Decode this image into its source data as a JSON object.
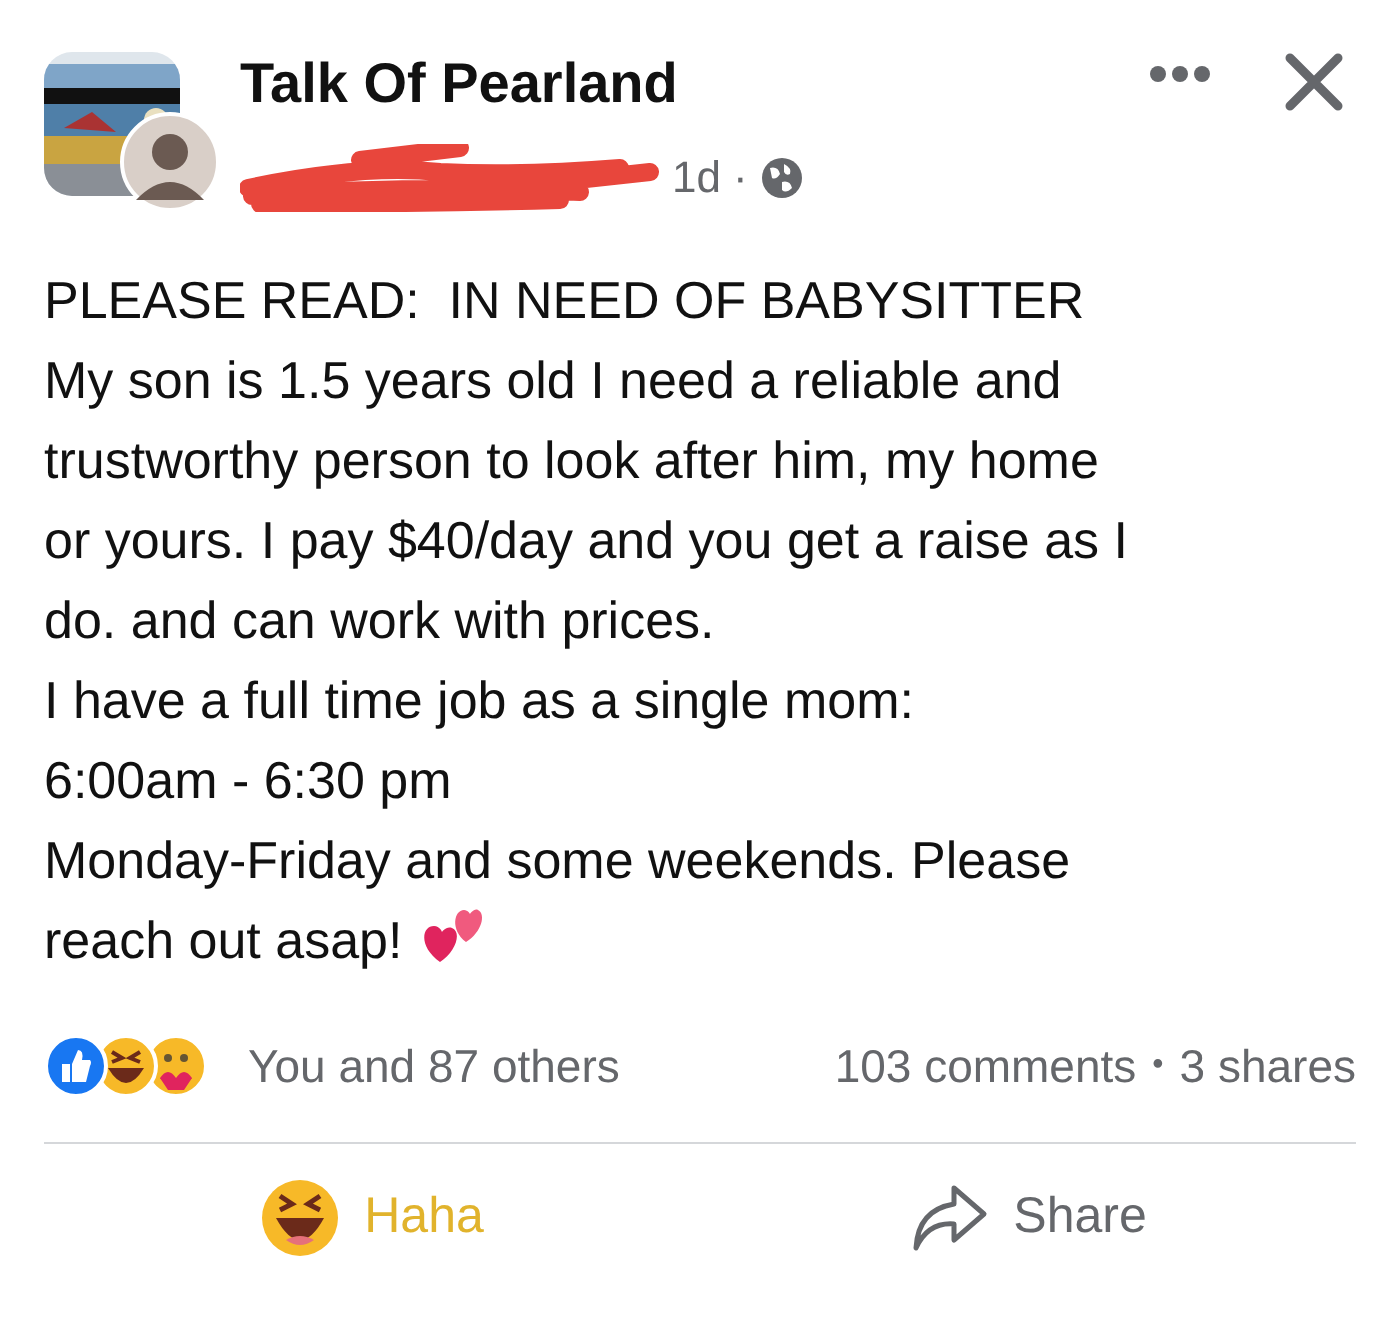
{
  "post": {
    "author": "Talk Of Pearland",
    "time": "1d",
    "separator": "·",
    "paragraphs": [
      "PLEASE READ:  IN NEED OF BABYSITTER",
      "My son is 1.5 years old I need a reliable and",
      "trustworthy person to look after him, my home",
      "or yours. I pay $40/day and you get a raise as I",
      "do. and can work with prices.",
      "I have a full time job as a single mom:",
      "6:00am - 6:30 pm",
      "Monday-Friday and some weekends. Please",
      "reach out asap!"
    ]
  },
  "reactions": {
    "summary": "You and 87 others",
    "comments": "103 comments",
    "dot": "•",
    "shares": "3 shares"
  },
  "actions": [
    {
      "kind": "haha",
      "label": "Haha",
      "reacted": true
    },
    {
      "kind": "share",
      "label": "Share",
      "reacted": false
    }
  ]
}
